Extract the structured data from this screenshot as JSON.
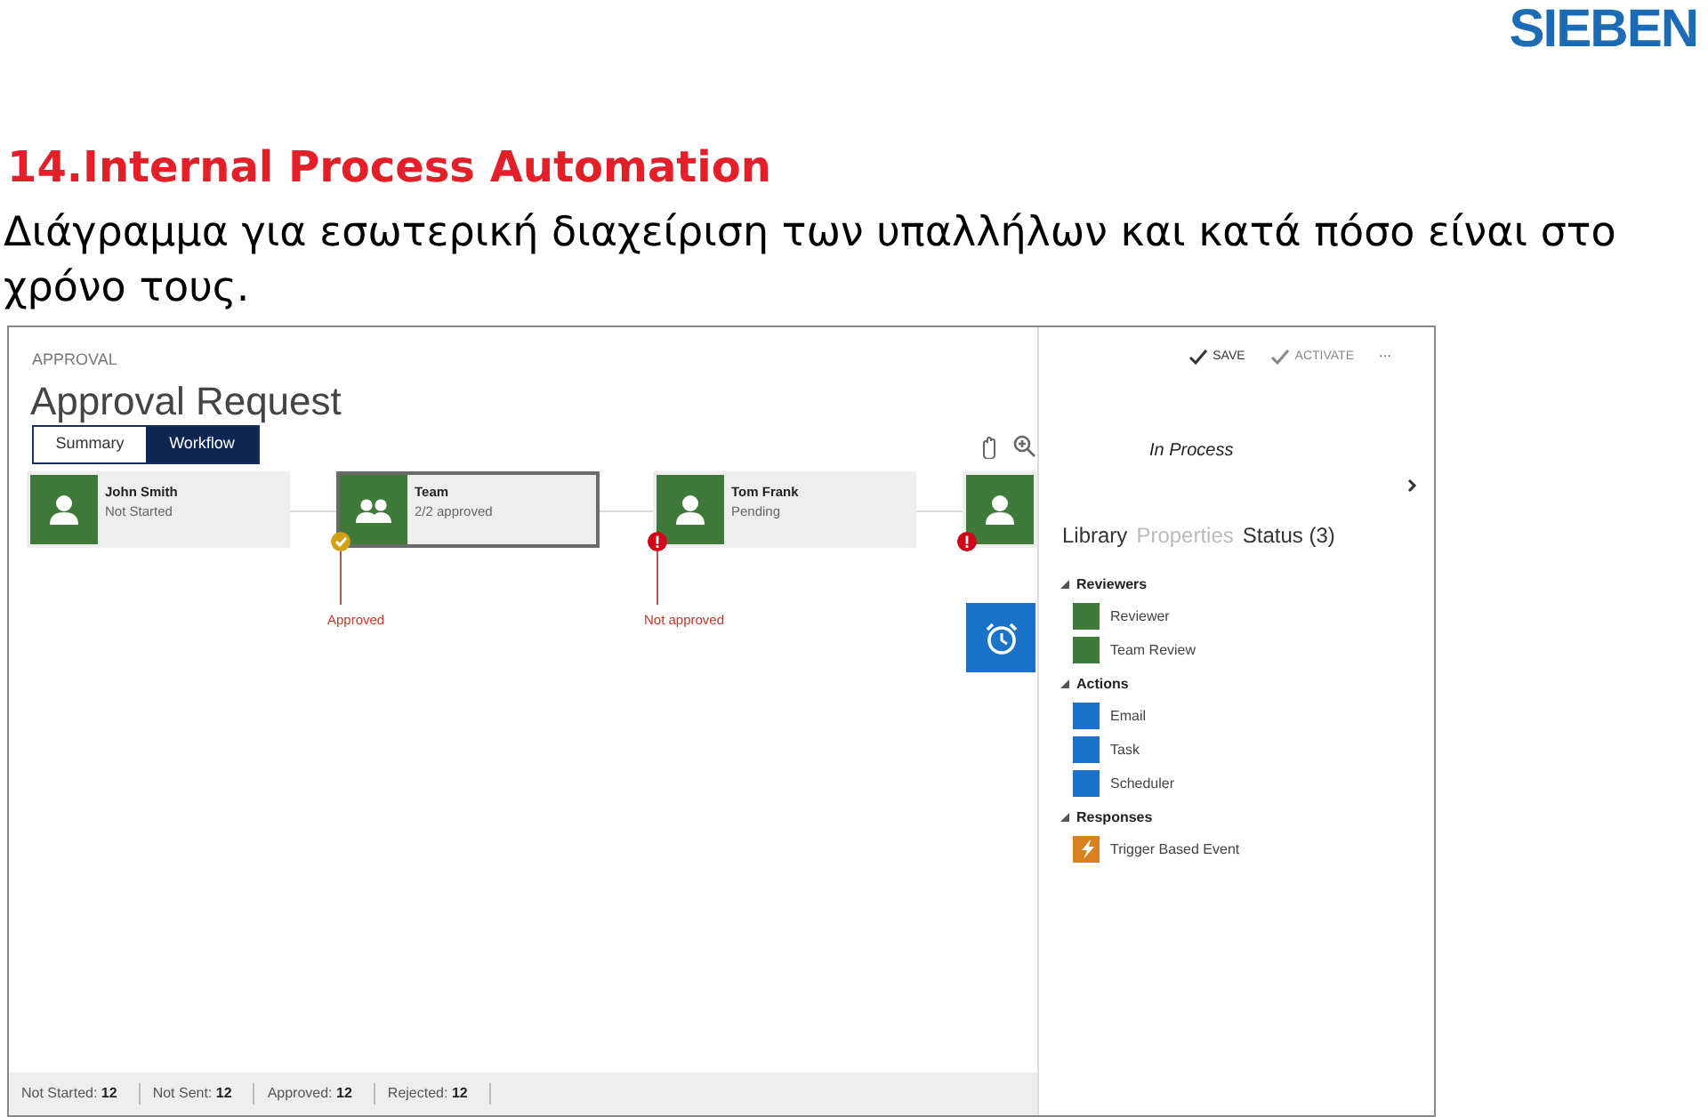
{
  "logo": "SIEBEN",
  "slide_title": "14.Internal Process Automation",
  "slide_subtitle": "Διάγραμμα για εσωτερική διαχείριση των υπαλλήλων και κατά πόσο είναι στο χρόνο τους.",
  "app": {
    "breadcrumb": "APPROVAL",
    "title": "Approval Request",
    "toolbar": [
      {
        "kind": "check",
        "label": "SAVE",
        "disabled": false
      },
      {
        "kind": "check",
        "label": "ACTIVATE",
        "disabled": true
      },
      {
        "kind": "more",
        "label": "···",
        "disabled": false
      }
    ],
    "tabs": [
      {
        "label": "Summary",
        "selected": false
      },
      {
        "label": "Workflow",
        "selected": true
      }
    ],
    "nodes": [
      {
        "kind": "person",
        "name": "John Smith",
        "status": "Not Started",
        "selected": false
      },
      {
        "kind": "team",
        "name": "Team",
        "status": "2/2 approved",
        "selected": true,
        "approved": true,
        "outcome_label": "Approved"
      },
      {
        "kind": "person",
        "name": "Tom Frank",
        "status": "Pending",
        "selected": false,
        "approved": false,
        "outcome_label": "Not approved"
      },
      {
        "kind": "person",
        "selected": false,
        "approved": false
      }
    ],
    "status_bar": [
      {
        "label": "Not Started:",
        "count": "12"
      },
      {
        "label": "Not Sent:",
        "count": "12"
      },
      {
        "label": "Approved:",
        "count": "12"
      },
      {
        "label": "Rejected:",
        "count": "12"
      }
    ],
    "panel": {
      "heading": "In Process",
      "tabs": [
        {
          "label": "Library",
          "disabled": false
        },
        {
          "label": "Properties",
          "disabled": true
        },
        {
          "label": "Status (3)",
          "disabled": false
        }
      ],
      "sections": [
        {
          "title": "Reviewers",
          "expanded": true,
          "items": [
            {
              "kind": "plain",
              "label": "Reviewer",
              "color": "#3f7a3a"
            },
            {
              "kind": "plain",
              "label": "Team Review",
              "color": "#3f7a3a"
            }
          ]
        },
        {
          "title": "Actions",
          "expanded": true,
          "items": [
            {
              "kind": "plain",
              "label": "Email",
              "color": "#1a73c9"
            },
            {
              "kind": "plain",
              "label": "Task",
              "color": "#1a73c9"
            },
            {
              "kind": "plain",
              "label": "Scheduler",
              "color": "#1a73c9"
            }
          ]
        },
        {
          "title": "Responses",
          "expanded": true,
          "items": [
            {
              "kind": "bolt",
              "label": "Trigger Based Event",
              "color": "#d9801f"
            }
          ]
        }
      ]
    }
  }
}
